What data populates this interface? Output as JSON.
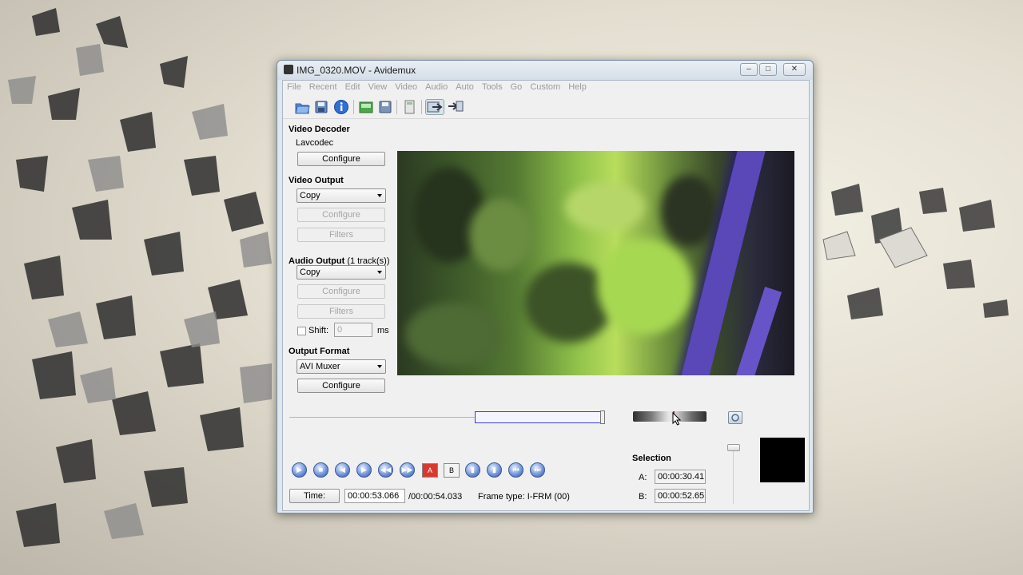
{
  "window": {
    "title": "IMG_0320.MOV - Avidemux",
    "controls": {
      "minimize": "–",
      "maximize": "□",
      "close": "✕"
    }
  },
  "menu": [
    "File",
    "Recent",
    "Edit",
    "View",
    "Video",
    "Audio",
    "Auto",
    "Tools",
    "Go",
    "Custom",
    "Help"
  ],
  "toolbar": {
    "icons": [
      "open-file-icon",
      "save-icon",
      "info-icon",
      "load-image-icon",
      "save-image-icon",
      "calculator-icon",
      "input-preview-icon",
      "output-preview-icon"
    ]
  },
  "left_panel": {
    "video_decoder": {
      "heading": "Video Decoder",
      "codec": "Lavcodec",
      "configure": "Configure"
    },
    "video_output": {
      "heading": "Video Output",
      "selected": "Copy",
      "configure": "Configure",
      "filters": "Filters"
    },
    "audio_output": {
      "heading": "Audio Output",
      "tracks": "(1 track(s))",
      "selected": "Copy",
      "configure": "Configure",
      "filters": "Filters",
      "shift_label": "Shift:",
      "shift_value": "0",
      "shift_unit": "ms"
    },
    "output_format": {
      "heading": "Output Format",
      "selected": "AVI Muxer",
      "configure": "Configure"
    }
  },
  "playback": {
    "buttons": [
      "play",
      "stop",
      "previous-frame",
      "next-frame",
      "previous-keyframe",
      "next-keyframe",
      "set-marker-a",
      "set-marker-b",
      "previous-black-frame",
      "next-black-frame",
      "go-to-first-frame",
      "go-to-last-frame"
    ],
    "marker_a_label": "A",
    "marker_b_label": "B",
    "position_fraction": 0.98,
    "selection_start_fraction": 0.58,
    "selection_end_fraction": 0.98
  },
  "status": {
    "time_button": "Time:",
    "current_time": "00:00:53.066",
    "total_time": "/00:00:54.033",
    "frame_type": "Frame type:  I-FRM (00)"
  },
  "selection": {
    "heading": "Selection",
    "a_label": "A:",
    "a_value": "00:00:30.41",
    "b_label": "B:",
    "b_value": "00:00:52.65"
  },
  "colors": {
    "accent": "#3b3bd0",
    "marker": "#d42020",
    "disabled_text": "#a5a5a5",
    "menu_disabled": "#9b9b9b"
  }
}
